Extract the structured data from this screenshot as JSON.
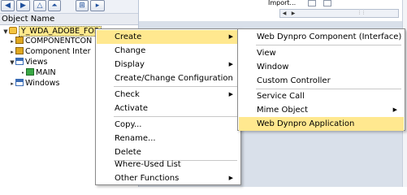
{
  "tree": {
    "header": "Object Name",
    "nodes": [
      {
        "label": "Y_WDA_ADOBE_FOR",
        "selected": true
      },
      {
        "label": "COMPONENTCON"
      },
      {
        "label": "Component Inter"
      },
      {
        "label": "Views"
      },
      {
        "label": "MAIN"
      },
      {
        "label": "Windows"
      }
    ]
  },
  "right_panel": {
    "column_header": "Import..."
  },
  "context_menu": {
    "items": [
      {
        "label": "Create",
        "submenu": true,
        "highlighted": true
      },
      {
        "label": "Change"
      },
      {
        "label": "Display",
        "submenu": true
      },
      {
        "label": "Create/Change Configuration"
      },
      {
        "label": "Check",
        "submenu": true
      },
      {
        "label": "Activate"
      },
      {
        "label": "Copy..."
      },
      {
        "label": "Rename..."
      },
      {
        "label": "Delete"
      },
      {
        "label": "Where-Used List"
      },
      {
        "label": "Other Functions",
        "submenu": true
      }
    ]
  },
  "create_submenu": {
    "items": [
      {
        "label": "Web Dynpro Component (Interface)"
      },
      {
        "label": "View"
      },
      {
        "label": "Window"
      },
      {
        "label": "Custom Controller"
      },
      {
        "label": "Service Call"
      },
      {
        "label": "Mime Object",
        "submenu": true
      },
      {
        "label": "Web Dynpro Application",
        "highlighted": true
      }
    ]
  },
  "colors": {
    "highlight": "#ffe88f",
    "selected_node": "#ffe98c",
    "panel_bg": "#d9e0ea"
  }
}
